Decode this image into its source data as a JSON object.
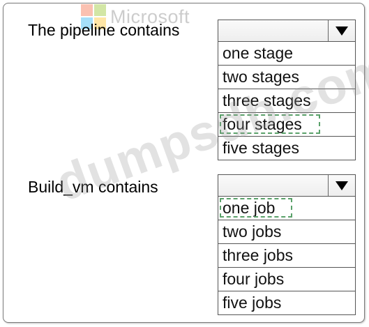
{
  "brand": {
    "name": "Microsoft"
  },
  "watermark": "dumpsdb.com",
  "question1": {
    "prompt": "The pipeline contains",
    "selected_value": "",
    "options": [
      "one stage",
      "two stages",
      "three stages",
      "four stages",
      "five stages"
    ],
    "highlighted": "four stages"
  },
  "question2": {
    "prompt": "Build_vm contains",
    "selected_value": "",
    "options": [
      "one job",
      "two jobs",
      "three jobs",
      "four jobs",
      "five jobs"
    ],
    "highlighted": "one job"
  },
  "colors": {
    "border": "#555555",
    "highlight_dash": "#5aa16a",
    "dropdown_bg": "#f4f4f4"
  },
  "icons": {
    "dropdown": "chevron-down-icon",
    "logo": "microsoft-logo-icon"
  }
}
